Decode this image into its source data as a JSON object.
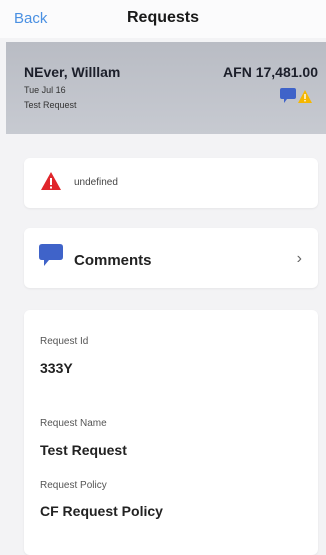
{
  "nav": {
    "back_label": "Back",
    "title": "Requests"
  },
  "summary": {
    "name": "NEver, Willlam",
    "amount": "AFN 17,481.00",
    "date": "Tue Jul 16",
    "description": "Test Request",
    "icons": [
      "comment-icon",
      "warning-icon"
    ],
    "colors": {
      "comment": "#3f63c9",
      "warning": "#f5b700"
    }
  },
  "warning_card": {
    "icon": "warning-icon",
    "text": "undefined",
    "color": "#e0262b"
  },
  "comments_card": {
    "icon": "comment-icon",
    "label": "Comments",
    "chevron": "›",
    "color": "#3f63c9"
  },
  "details": [
    {
      "label": "Request Id",
      "value": "333Y"
    },
    {
      "label": "Request Name",
      "value": "Test Request"
    },
    {
      "label": "Request Policy",
      "value": "CF Request Policy"
    }
  ]
}
